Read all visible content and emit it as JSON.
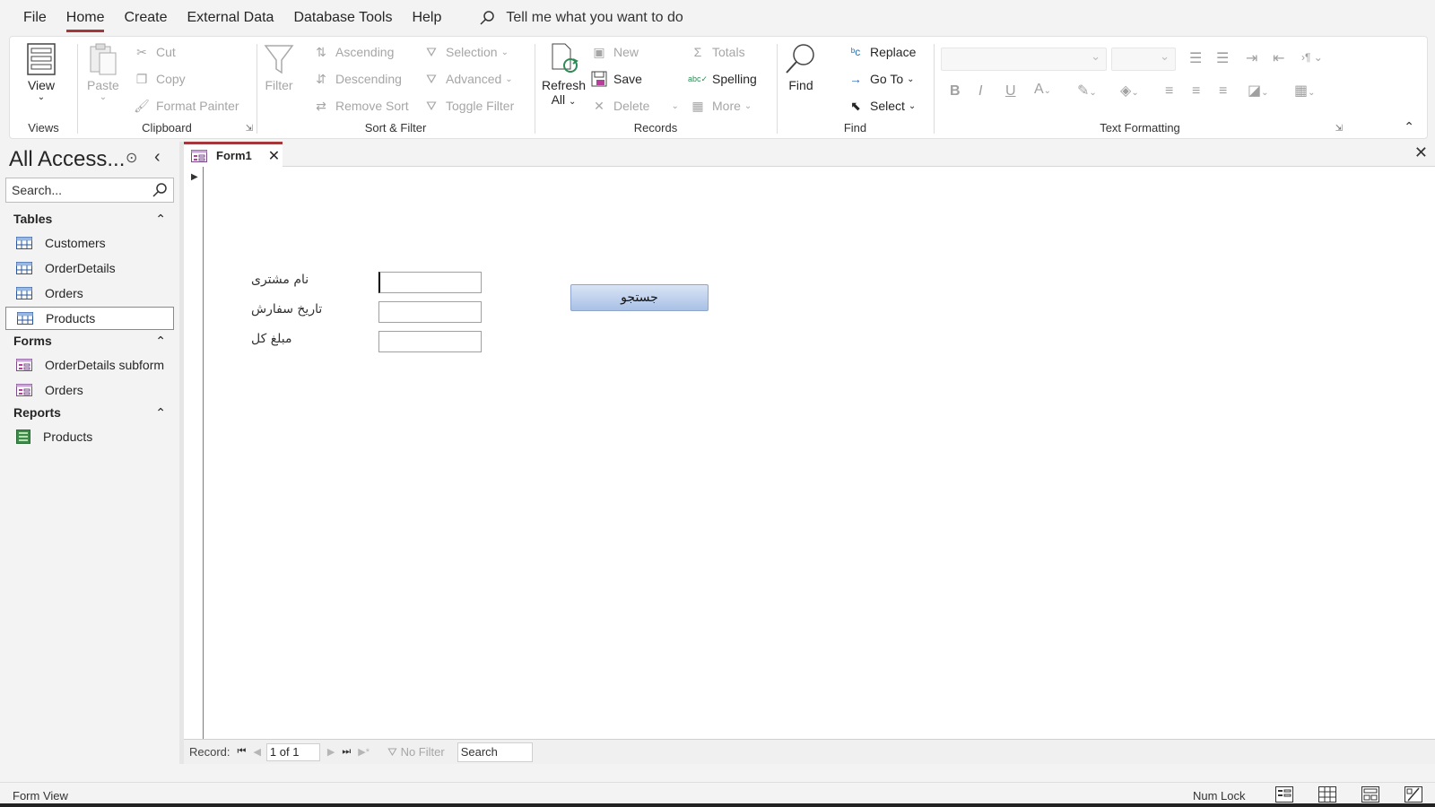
{
  "menu": {
    "items": [
      {
        "id": "file",
        "label": "File"
      },
      {
        "id": "home",
        "label": "Home"
      },
      {
        "id": "create",
        "label": "Create"
      },
      {
        "id": "external-data",
        "label": "External Data"
      },
      {
        "id": "database-tools",
        "label": "Database Tools"
      },
      {
        "id": "help",
        "label": "Help"
      }
    ],
    "active": "Home",
    "tell_me": "Tell me what you want to do"
  },
  "ribbon": {
    "views": {
      "label": "Views",
      "view": "View"
    },
    "clipboard": {
      "label": "Clipboard",
      "paste": "Paste",
      "cut": "Cut",
      "copy": "Copy",
      "format_painter": "Format Painter"
    },
    "sort_filter": {
      "label": "Sort & Filter",
      "filter": "Filter",
      "ascending": "Ascending",
      "descending": "Descending",
      "remove_sort": "Remove Sort",
      "selection": "Selection",
      "advanced": "Advanced",
      "toggle_filter": "Toggle Filter"
    },
    "records": {
      "label": "Records",
      "refresh": "Refresh",
      "refresh_all": "All",
      "new": "New",
      "save": "Save",
      "delete": "Delete",
      "totals": "Totals",
      "spelling": "Spelling",
      "more": "More"
    },
    "find": {
      "label": "Find",
      "find": "Find",
      "replace": "Replace",
      "go_to": "Go To",
      "select": "Select"
    },
    "text_formatting": {
      "label": "Text Formatting",
      "bold": "B",
      "italic": "I",
      "underline": "U"
    }
  },
  "nav_pane": {
    "title": "All Access...",
    "search_placeholder": "Search...",
    "sections": [
      {
        "name": "Tables",
        "items": [
          "Customers",
          "OrderDetails",
          "Orders",
          "Products"
        ]
      },
      {
        "name": "Forms",
        "items": [
          "OrderDetails subform",
          "Orders"
        ]
      },
      {
        "name": "Reports",
        "items": [
          "Products"
        ]
      }
    ],
    "selected_item": "Products"
  },
  "document": {
    "tab_label": "Form1",
    "form": {
      "fields": [
        {
          "label": "نام مشتری",
          "value": ""
        },
        {
          "label": "تاریخ سفارش",
          "value": ""
        },
        {
          "label": "مبلغ کل",
          "value": ""
        }
      ],
      "search_button": "جستجو"
    },
    "record_nav": {
      "label": "Record:",
      "position": "1 of 1",
      "no_filter": "No Filter",
      "search": "Search"
    }
  },
  "status_bar": {
    "left": "Form View",
    "num_lock": "Num Lock"
  },
  "colors": {
    "accent": "#a4373a",
    "button_top": "#d9e4f5",
    "button_bottom": "#a9c1e6"
  }
}
